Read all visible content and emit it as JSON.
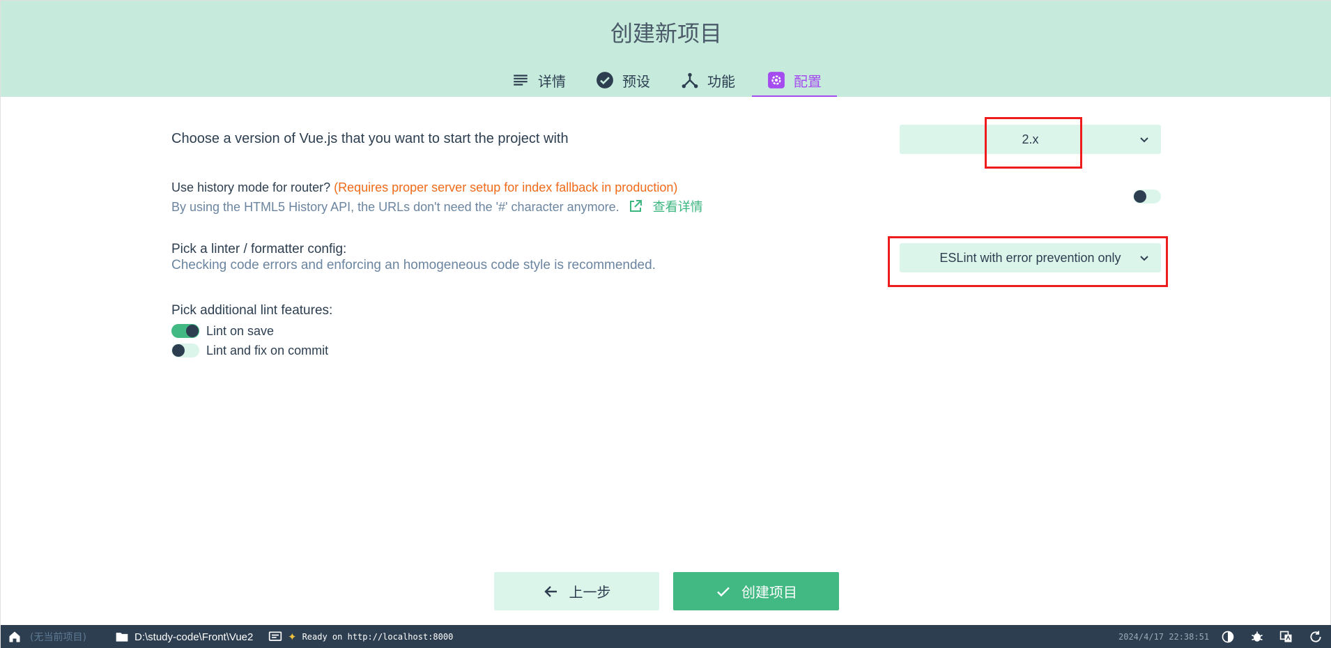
{
  "header": {
    "title": "创建新项目",
    "tabs": [
      {
        "label": "详情",
        "icon": "list-icon"
      },
      {
        "label": "预设",
        "icon": "check-circle-icon"
      },
      {
        "label": "功能",
        "icon": "fork-icon"
      },
      {
        "label": "配置",
        "icon": "gear-icon",
        "active": true
      }
    ]
  },
  "config": {
    "vue_version": {
      "label": "Choose a version of Vue.js that you want to start the project with",
      "value": "2.x"
    },
    "history_mode": {
      "label": "Use history mode for router?",
      "warning": "(Requires proper server setup for index fallback in production)",
      "description": "By using the HTML5 History API, the URLs don't need the '#' character anymore.",
      "link": "查看详情",
      "enabled": false
    },
    "linter": {
      "label": "Pick a linter / formatter config:",
      "description": "Checking code errors and enforcing an homogeneous code style is recommended.",
      "value": "ESLint with error prevention only"
    },
    "lint_features": {
      "label": "Pick additional lint features:",
      "items": [
        {
          "label": "Lint on save",
          "enabled": true
        },
        {
          "label": "Lint and fix on commit",
          "enabled": false
        }
      ]
    }
  },
  "actions": {
    "prev_label": "上一步",
    "create_label": "创建项目"
  },
  "statusbar": {
    "no_project": "(无当前项目)",
    "path": "D:\\study-code\\Front\\Vue2",
    "log": "Ready on http://localhost:8000",
    "datetime": "2024/4/17 22:38:51"
  },
  "colors": {
    "header_bg": "#c6eadc",
    "accent_purple": "#a44cf0",
    "accent_green": "#42b983",
    "warning_orange": "#f06a1a",
    "highlight_red": "#ee1c1c",
    "statusbar_bg": "#2c3e50"
  }
}
